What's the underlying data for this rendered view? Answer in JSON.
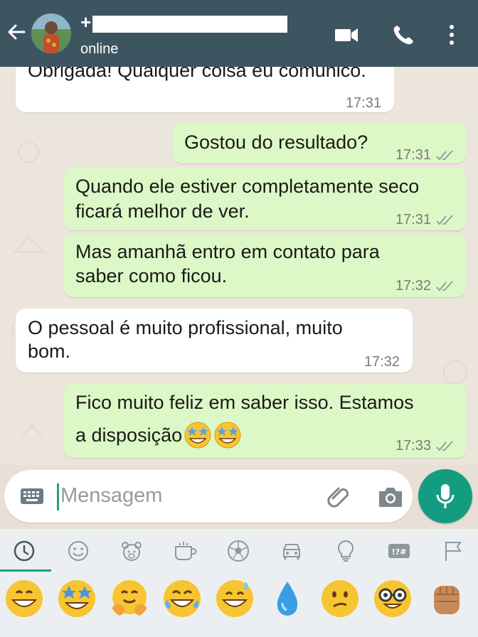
{
  "header": {
    "plus_sign": "+",
    "status": "online"
  },
  "messages": [
    {
      "dir": "in",
      "text_lines": [
        "Obrigada! Qualquer coisa eu comunico."
      ],
      "time": "17:31",
      "ticks": false
    },
    {
      "dir": "out",
      "text_lines": [
        "Gostou do resultado?"
      ],
      "time": "17:31",
      "ticks": true
    },
    {
      "dir": "out",
      "text_lines": [
        "Quando ele estiver completamente seco",
        "ficará melhor de ver."
      ],
      "time": "17:31",
      "ticks": true
    },
    {
      "dir": "out",
      "text_lines": [
        "Mas amanhã entro em contato para",
        "saber como ficou."
      ],
      "time": "17:32",
      "ticks": true
    },
    {
      "dir": "in",
      "text_lines": [
        "O pessoal é muito profissional, muito",
        "bom."
      ],
      "time": "17:32",
      "ticks": false
    },
    {
      "dir": "out",
      "text_lines": [
        "Fico muito feliz em saber isso. Estamos",
        "a disposição"
      ],
      "time": "17:33",
      "ticks": true,
      "emojis": [
        "star-struck",
        "star-struck"
      ]
    }
  ],
  "input": {
    "placeholder": "Mensagem"
  },
  "keyboard": {
    "categories": [
      "recent-clock-icon",
      "smiley-icon",
      "animal-icon",
      "food-cup-icon",
      "sports-ball-icon",
      "car-icon",
      "lightbulb-icon",
      "symbols-icon",
      "flag-icon"
    ],
    "emojis": [
      "grinning-face",
      "star-struck",
      "hugging-face",
      "tears-of-joy",
      "grinning-sweat",
      "droplet",
      "confused-face",
      "nerd-face",
      "fist"
    ]
  },
  "colors": {
    "header": "#3d5560",
    "outgoing_bubble": "#dcf8c6",
    "incoming_bubble": "#ffffff",
    "accent": "#1f9e86"
  }
}
